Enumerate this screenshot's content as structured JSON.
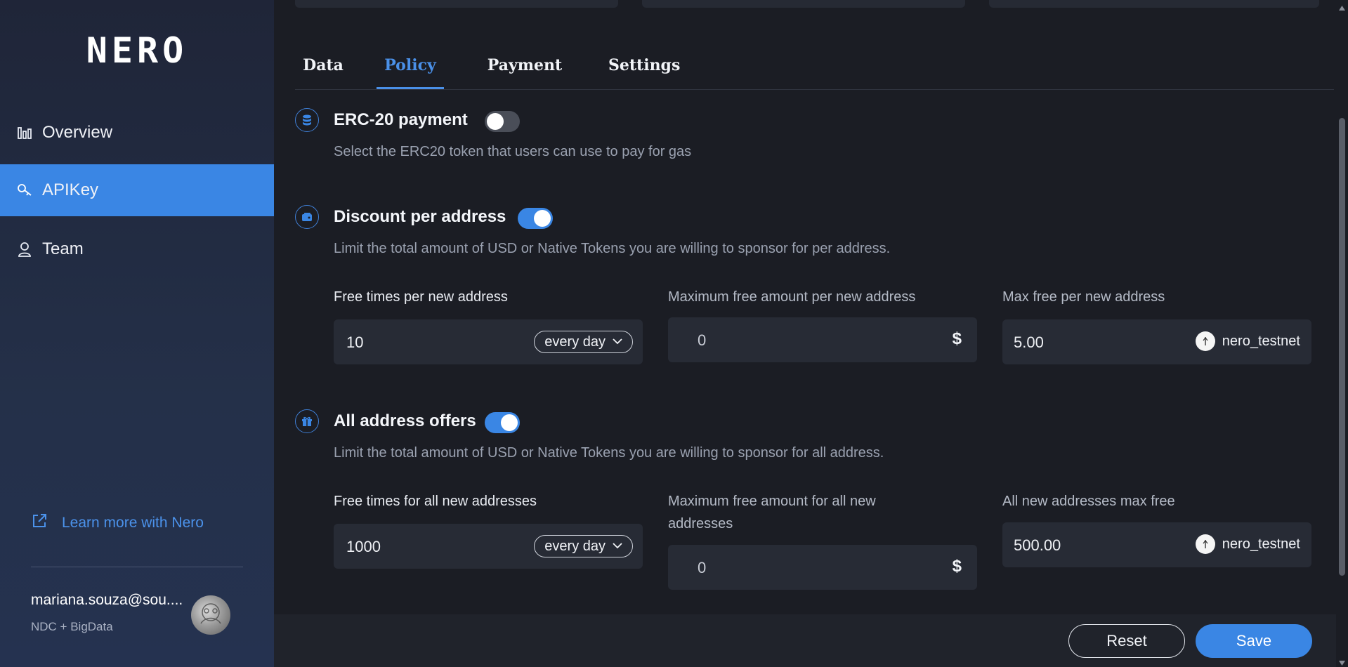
{
  "brand": {
    "logo_text": "NERO"
  },
  "sidebar": {
    "items": [
      {
        "label": "Overview",
        "icon": "bar-chart-icon",
        "active": false
      },
      {
        "label": "APIKey",
        "icon": "key-icon",
        "active": true
      },
      {
        "label": "Team",
        "icon": "person-icon",
        "active": false
      }
    ],
    "learn_more": "Learn more with Nero",
    "user": {
      "email": "mariana.souza@sou....",
      "org": "NDC + BigData"
    }
  },
  "tabs": [
    {
      "label": "Data",
      "active": false
    },
    {
      "label": "Policy",
      "active": true
    },
    {
      "label": "Payment",
      "active": false
    },
    {
      "label": "Settings",
      "active": false
    }
  ],
  "sections": {
    "erc20": {
      "title": "ERC-20 payment",
      "enabled": false,
      "description": "Select the ERC20 token that users can use to pay for gas",
      "icon": "coin-stack-icon"
    },
    "discount": {
      "title": "Discount per address",
      "enabled": true,
      "description": "Limit the total amount of USD or Native Tokens you are willing to sponsor for per address.",
      "icon": "wallet-icon",
      "free_times_label": "Free times per new address",
      "free_times_value": "10",
      "free_times_period": "every day",
      "max_amount_label": "Maximum free amount per new address",
      "max_amount_value": "0",
      "max_amount_unit": "$",
      "max_free_label": "Max free per new address",
      "max_free_value": "5.00",
      "max_free_token": "nero_testnet"
    },
    "all_offers": {
      "title": "All address offers",
      "enabled": true,
      "description": "Limit the total amount of USD or Native Tokens you are willing to sponsor for all address.",
      "icon": "gift-icon",
      "free_times_label": "Free times for all new addresses",
      "free_times_value": "1000",
      "free_times_period": "every day",
      "max_amount_label": "Maximum free amount for all new addresses",
      "max_amount_value": "0",
      "max_amount_unit": "$",
      "max_free_label": "All new addresses max free",
      "max_free_value": "500.00",
      "max_free_token": "nero_testnet"
    }
  },
  "footer": {
    "reset_label": "Reset",
    "save_label": "Save"
  },
  "colors": {
    "accent": "#3a86e4",
    "sidebar_bg": "#243049",
    "main_bg": "#1b1d24",
    "field_bg": "#272b35"
  }
}
